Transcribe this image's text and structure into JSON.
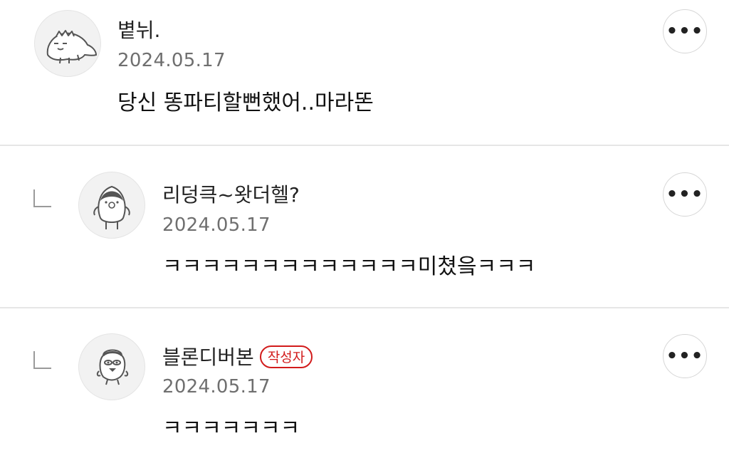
{
  "comments": [
    {
      "author": "볕뉘.",
      "date": "2024.05.17",
      "text": "당신 똥파티할뻔했어..마라똔",
      "avatar_icon": "dinosaur-avatar-icon",
      "is_reply": false,
      "more_label": "•••"
    },
    {
      "author": "리덩큭~왓더헬?",
      "date": "2024.05.17",
      "text": "ㅋㅋㅋㅋㅋㅋㅋㅋㅋㅋㅋㅋㅋ미쳤읔ㅋㅋㅋ",
      "avatar_icon": "penguin-avatar-icon",
      "is_reply": true,
      "more_label": "•••"
    },
    {
      "author": "블론디버본",
      "badge": "작성자",
      "date": "2024.05.17",
      "text": "ㅋㅋㅋㅋㅋㅋㅋ",
      "avatar_icon": "bird-avatar-icon",
      "is_reply": true,
      "more_label": "•••"
    }
  ],
  "colors": {
    "badge_red": "#d21b1b",
    "date_gray": "#6f6f6f",
    "divider": "#e6e6e6"
  }
}
